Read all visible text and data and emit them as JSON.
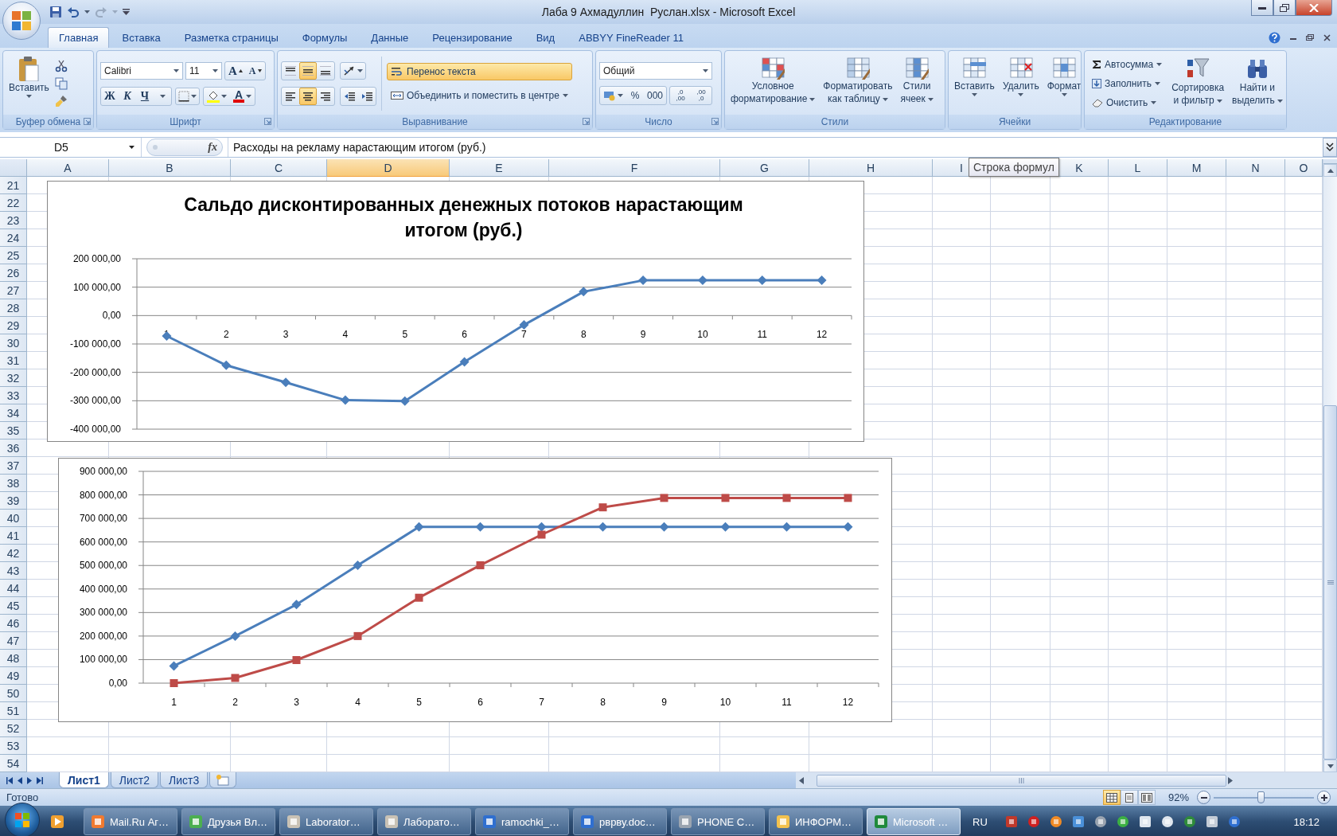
{
  "window": {
    "title": "Лаба 9 Ахмадуллин  Руслан.xlsx - Microsoft Excel"
  },
  "tabs": [
    {
      "label": "Главная",
      "selected": true
    },
    {
      "label": "Вставка",
      "selected": false
    },
    {
      "label": "Разметка страницы",
      "selected": false
    },
    {
      "label": "Формулы",
      "selected": false
    },
    {
      "label": "Данные",
      "selected": false
    },
    {
      "label": "Рецензирование",
      "selected": false
    },
    {
      "label": "Вид",
      "selected": false
    },
    {
      "label": "ABBYY FineReader 11",
      "selected": false
    }
  ],
  "ribbon": {
    "clipboard": {
      "label": "Буфер обмена",
      "paste": "Вставить"
    },
    "font": {
      "label": "Шрифт",
      "font_name": "Calibri",
      "font_size": "11",
      "grow": "A",
      "shrink": "A",
      "bold": "Ж",
      "italic": "К",
      "underline": "Ч",
      "font_color": "А"
    },
    "alignment": {
      "label": "Выравнивание",
      "vertical": [
        {
          "selected": false
        },
        {
          "selected": true
        },
        {
          "selected": false
        }
      ],
      "horizontal": [
        {
          "selected": false
        },
        {
          "selected": true
        },
        {
          "selected": false
        }
      ],
      "wrap": {
        "label": "Перенос текста",
        "on": true
      },
      "merge": "Объединить и поместить в центре"
    },
    "number": {
      "label": "Число",
      "format": "Общий",
      "percent": "%",
      "thousands": "000",
      "decimals": [
        [
          ",0",
          ",00"
        ],
        [
          ",00",
          ",0"
        ]
      ]
    },
    "styles": {
      "label": "Стили",
      "buttons": [
        [
          "Условное",
          "форматирование"
        ],
        [
          "Форматировать",
          "как таблицу"
        ],
        [
          "Стили",
          "ячеек"
        ]
      ]
    },
    "cells": {
      "label": "Ячейки",
      "buttons": [
        "Вставить",
        "Удалить",
        "Формат"
      ]
    },
    "editing": {
      "label": "Редактирование",
      "small": [
        "Автосумма",
        "Заполнить",
        "Очистить"
      ],
      "big": [
        [
          "Сортировка",
          "и фильтр"
        ],
        [
          "Найти и",
          "выделить"
        ]
      ]
    }
  },
  "formula_bar": {
    "name_box": "D5",
    "function_button": "fx",
    "value": "Расходы на рекламу нарастающим итогом (руб.)",
    "tooltip": "Строка формул"
  },
  "columns": [
    {
      "label": "A",
      "selected": false
    },
    {
      "label": "B",
      "selected": false
    },
    {
      "label": "C",
      "selected": false
    },
    {
      "label": "D",
      "selected": true
    },
    {
      "label": "E",
      "selected": false
    },
    {
      "label": "F",
      "selected": false
    },
    {
      "label": "G",
      "selected": false
    },
    {
      "label": "H",
      "selected": false
    },
    {
      "label": "I",
      "selected": false
    },
    {
      "label": "K",
      "selected": false
    },
    {
      "label": "L",
      "selected": false
    },
    {
      "label": "M",
      "selected": false
    },
    {
      "label": "N",
      "selected": false
    },
    {
      "label": "O",
      "selected": false
    }
  ],
  "rows": [
    "21",
    "22",
    "23",
    "24",
    "25",
    "26",
    "27",
    "28",
    "29",
    "30",
    "31",
    "32",
    "33",
    "34",
    "35",
    "36",
    "37",
    "38",
    "39",
    "40",
    "41",
    "42",
    "43",
    "44",
    "45",
    "46",
    "47",
    "48",
    "49",
    "50",
    "51",
    "52",
    "53",
    "54"
  ],
  "charts": [
    {
      "chart_data": {
        "type": "line",
        "title": "Сальдо дисконтированных денежных потоков нарастающим итогом (руб.)",
        "categories": [
          "1",
          "2",
          "3",
          "4",
          "5",
          "6",
          "7",
          "8",
          "9",
          "10",
          "11",
          "12"
        ],
        "grid": true,
        "series": [
          {
            "color": "#4a7ebb",
            "marker": "diamond",
            "values": [
              -72000,
              -175000,
              -235000,
              -298000,
              -301000,
              -163000,
              -33000,
              84000,
              124000,
              124000,
              124000,
              124000
            ]
          }
        ],
        "ylim": [
          -400000,
          200000
        ],
        "yticks": [
          {
            "value": 200000,
            "label": "200 000,00"
          },
          {
            "value": 100000,
            "label": "100 000,00"
          },
          {
            "value": 0,
            "label": "0,00"
          },
          {
            "value": -100000,
            "label": "-100 000,00"
          },
          {
            "value": -200000,
            "label": "-200 000,00"
          },
          {
            "value": -300000,
            "label": "-300 000,00"
          },
          {
            "value": -400000,
            "label": "-400 000,00"
          }
        ]
      }
    },
    {
      "chart_data": {
        "type": "line",
        "categories": [
          "1",
          "2",
          "3",
          "4",
          "5",
          "6",
          "7",
          "8",
          "9",
          "10",
          "11",
          "12"
        ],
        "grid": true,
        "series": [
          {
            "color": "#4a7ebb",
            "marker": "diamond",
            "values": [
              73000,
              200000,
              334000,
              501000,
              664000,
              664000,
              664000,
              664000,
              664000,
              664000,
              664000,
              664000
            ]
          },
          {
            "color": "#be4b48",
            "marker": "square",
            "values": [
              0,
              22000,
              98000,
              200000,
              363000,
              501000,
              631000,
              747000,
              787000,
              787000,
              787000,
              787000
            ]
          }
        ],
        "ylim": [
          0,
          900000
        ],
        "yticks": [
          {
            "value": 900000,
            "label": "900 000,00"
          },
          {
            "value": 800000,
            "label": "800 000,00"
          },
          {
            "value": 700000,
            "label": "700 000,00"
          },
          {
            "value": 600000,
            "label": "600 000,00"
          },
          {
            "value": 500000,
            "label": "500 000,00"
          },
          {
            "value": 400000,
            "label": "400 000,00"
          },
          {
            "value": 300000,
            "label": "300 000,00"
          },
          {
            "value": 200000,
            "label": "200 000,00"
          },
          {
            "value": 100000,
            "label": "100 000,00"
          },
          {
            "value": 0,
            "label": "0,00"
          }
        ]
      }
    }
  ],
  "sheet_tabs": [
    {
      "label": "Лист1",
      "selected": true
    },
    {
      "label": "Лист2",
      "selected": false
    },
    {
      "label": "Лист3",
      "selected": false
    }
  ],
  "status_bar": {
    "status": "Готово",
    "views": [
      {
        "selected": true
      },
      {
        "selected": false
      },
      {
        "selected": false
      }
    ],
    "zoom": "92%",
    "zoom_slider": {
      "level": 0.47
    }
  },
  "taskbar": {
    "items": [
      {
        "label": "Mail.Ru Аг…",
        "selected": false
      },
      {
        "label": "Друзья Вл…",
        "selected": false
      },
      {
        "label": "Laborator…",
        "selected": false
      },
      {
        "label": "Лаборато…",
        "selected": false
      },
      {
        "label": "ramochki_…",
        "selected": false
      },
      {
        "label": "рврву.doc…",
        "selected": false
      },
      {
        "label": "PHONE C…",
        "selected": false
      },
      {
        "label": "ИНФОРМ…",
        "selected": false
      },
      {
        "label": "Microsoft …",
        "selected": true
      }
    ],
    "language": "RU",
    "clock": "18:12"
  }
}
